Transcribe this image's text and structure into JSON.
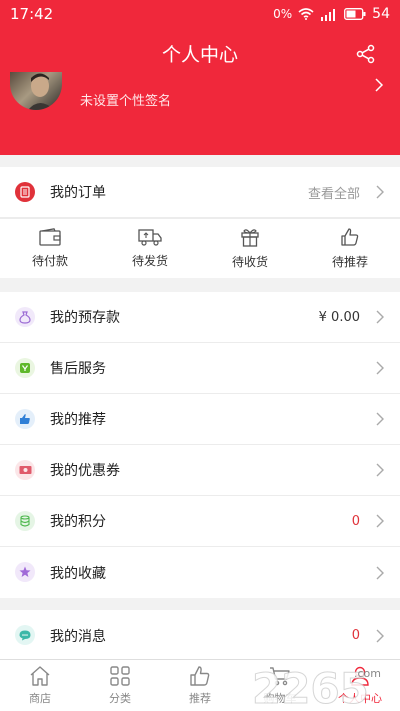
{
  "status_bar": {
    "time": "17:42",
    "battery": "54"
  },
  "header": {
    "title": "个人中心",
    "signature": "未设置个性签名"
  },
  "orders": {
    "label": "我的订单",
    "view_all": "查看全部",
    "statuses": [
      "待付款",
      "待发货",
      "待收货",
      "待推荐"
    ]
  },
  "menu": [
    {
      "label": "我的预存款",
      "value": "¥ 0.00",
      "icon": "money-bag-icon",
      "color": "#9b6bd4"
    },
    {
      "label": "售后服务",
      "value": "",
      "icon": "service-icon",
      "color": "#5fb82a"
    },
    {
      "label": "我的推荐",
      "value": "",
      "icon": "thumb-up-icon",
      "color": "#2f7fd6"
    },
    {
      "label": "我的优惠券",
      "value": "",
      "icon": "coupon-icon",
      "color": "#e05b6b"
    },
    {
      "label": "我的积分",
      "value": "0",
      "icon": "points-icon",
      "color": "#4fb84f"
    },
    {
      "label": "我的收藏",
      "value": "",
      "icon": "star-icon",
      "color": "#a06ad8"
    }
  ],
  "messages": {
    "label": "我的消息",
    "value": "0",
    "icon": "message-icon",
    "color": "#3cb8a8"
  },
  "tabbar": [
    "商店",
    "分类",
    "推荐",
    "购物车",
    "个人中心"
  ],
  "watermark": "2265.com",
  "colors": {
    "primary": "#f0283b",
    "background": "#f2f2f2"
  }
}
